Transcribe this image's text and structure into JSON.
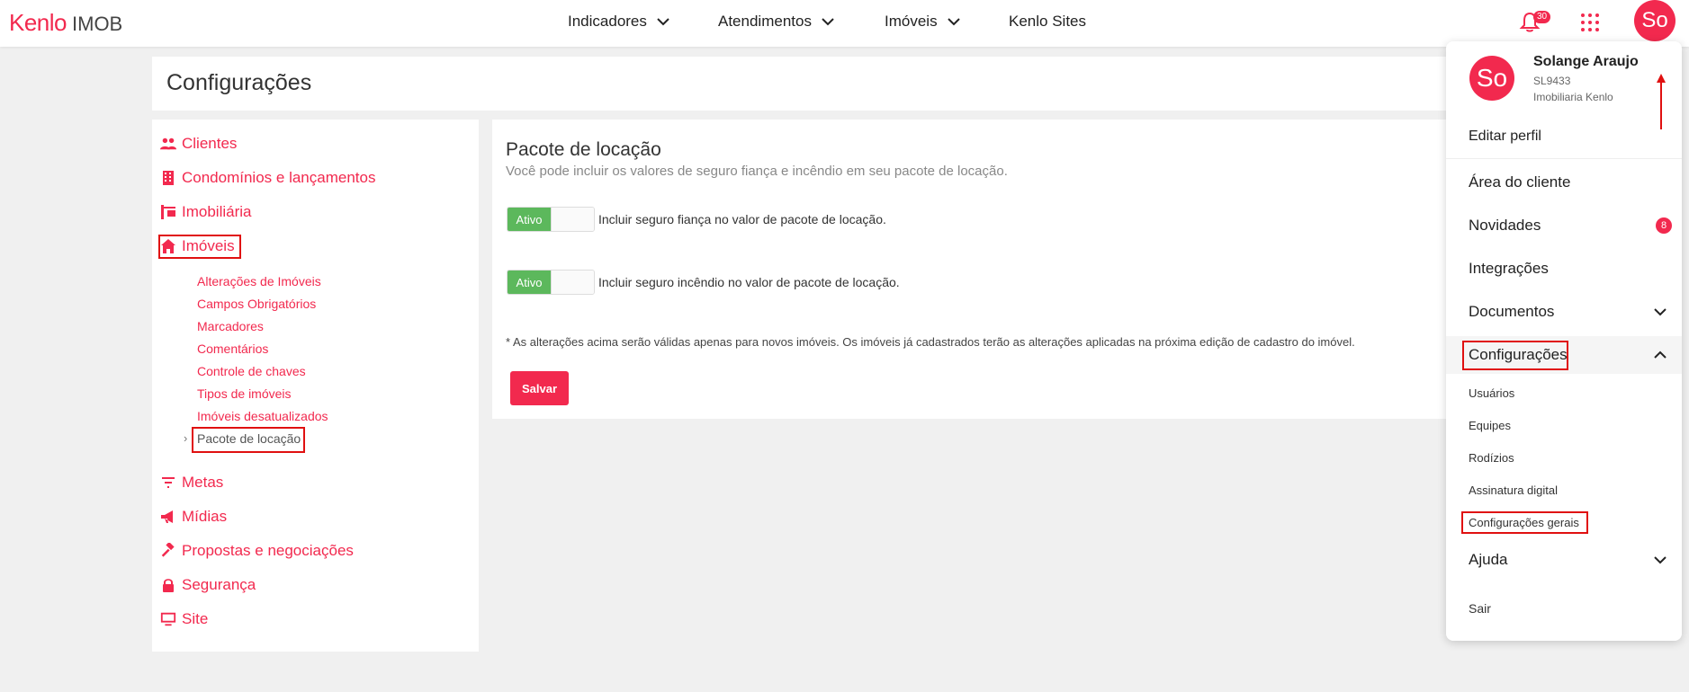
{
  "brand": {
    "name": "Kenlo",
    "product": "IMOB",
    "accent": "#f2294e"
  },
  "nav": {
    "indicadores": "Indicadores",
    "atendimentos": "Atendimentos",
    "imoveis": "Imóveis",
    "sites": "Kenlo Sites"
  },
  "header": {
    "notifications_count": "30",
    "avatar_initials": "So"
  },
  "page": {
    "title": "Configurações"
  },
  "sidebar": {
    "clientes": "Clientes",
    "condominios": "Condomínios e lançamentos",
    "imobiliaria": "Imobiliária",
    "imoveis": "Imóveis",
    "sub": [
      "Alterações de Imóveis",
      "Campos Obrigatórios",
      "Marcadores",
      "Comentários",
      "Controle de chaves",
      "Tipos de imóveis",
      "Imóveis desatualizados",
      "Pacote de locação"
    ],
    "metas": "Metas",
    "midias": "Mídias",
    "propostas": "Propostas e negociações",
    "seguranca": "Segurança",
    "site": "Site"
  },
  "content": {
    "title": "Pacote de locação",
    "subtitle": "Você pode incluir os valores de seguro fiança e incêndio em seu pacote de locação.",
    "toggle_on_label": "Ativo",
    "toggle1_label": "Incluir seguro fiança no valor de pacote de locação.",
    "toggle2_label": "Incluir seguro incêndio no valor de pacote de locação.",
    "note": "* As alterações acima serão válidas apenas para novos imóveis. Os imóveis já cadastrados terão as alterações aplicadas na próxima edição de cadastro do imóvel.",
    "save": "Salvar"
  },
  "dropdown": {
    "initials": "So",
    "name": "Solange Araujo",
    "code": "SL9433",
    "company": "Imobiliaria Kenlo",
    "edit_profile": "Editar perfil",
    "area_cliente": "Área do cliente",
    "novidades": "Novidades",
    "novidades_count": "8",
    "integracoes": "Integrações",
    "documentos": "Documentos",
    "configuracoes": "Configurações",
    "config_sub": [
      "Usuários",
      "Equipes",
      "Rodízios",
      "Assinatura digital",
      "Configurações gerais"
    ],
    "ajuda": "Ajuda",
    "sair": "Sair"
  }
}
